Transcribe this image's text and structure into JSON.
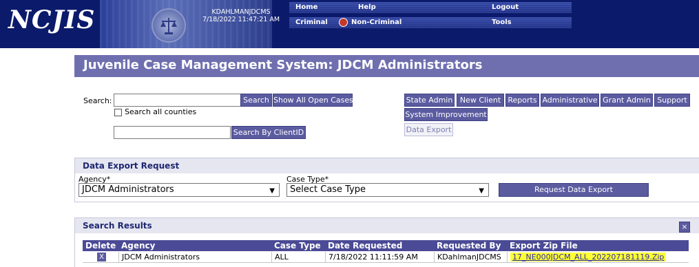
{
  "header": {
    "logo": "NCJIS",
    "user_name": "KDAHLMANJDCMS",
    "datetime": "7/18/2022 11:47:21 AM",
    "menu": {
      "home": "Home",
      "help": "Help",
      "logout": "Logout",
      "criminal": "Criminal",
      "non_criminal": "Non-Criminal",
      "tools": "Tools"
    }
  },
  "page_title": "Juvenile Case Management System: JDCM Administrators",
  "search": {
    "label": "Search:",
    "value": "",
    "search_button": "Search",
    "show_all_button": "Show All Open Cases",
    "all_counties_label": "Search all counties",
    "all_counties_checked": false,
    "clientid_value": "",
    "clientid_button": "Search By ClientID"
  },
  "admin_buttons": {
    "state_admin": "State Admin",
    "new_client": "New Client",
    "reports": "Reports",
    "administrative": "Administrative",
    "grant_admin": "Grant Admin",
    "support": "Support",
    "system_improvement": "System Improvement",
    "data_export": "Data Export"
  },
  "data_export": {
    "heading": "Data Export Request",
    "agency_label": "Agency*",
    "agency_value": "JDCM Administrators",
    "case_type_label": "Case Type*",
    "case_type_value": "Select Case Type",
    "request_button": "Request Data Export"
  },
  "results": {
    "heading": "Search Results",
    "close_label": "×",
    "columns": {
      "delete": "Delete",
      "agency": "Agency",
      "case_type": "Case Type",
      "date_requested": "Date Requested",
      "requested_by": "Requested By",
      "export_zip": "Export Zip File"
    },
    "rows": [
      {
        "delete": "X",
        "agency": "JDCM Administrators",
        "case_type": "ALL",
        "date_requested": "7/18/2022 11:11:59 AM",
        "requested_by": "KDahlmanJDCMS",
        "export_zip": "17_NE000JDCM_ALL_202207181119.Zip"
      }
    ]
  },
  "colors": {
    "header_bg": "#0b1a6b",
    "title_bar": "#6f6fb0",
    "button": "#5b5ba0",
    "table_header": "#4a4a96",
    "highlight": "#ffff33"
  }
}
